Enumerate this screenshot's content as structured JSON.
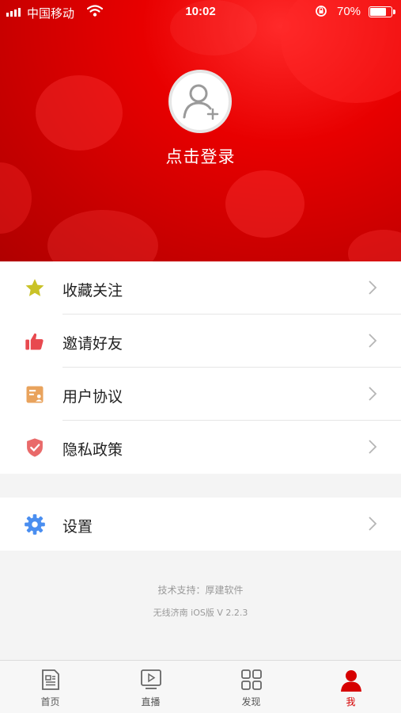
{
  "status_bar": {
    "carrier": "中国移动",
    "time": "10:02",
    "battery_percent": "70%",
    "battery_level": 0.7
  },
  "profile": {
    "login_label": "点击登录"
  },
  "menu": {
    "items": [
      {
        "label": "收藏关注",
        "icon": "star-icon"
      },
      {
        "label": "邀请好友",
        "icon": "thumbs-up-icon"
      },
      {
        "label": "用户协议",
        "icon": "document-icon"
      },
      {
        "label": "隐私政策",
        "icon": "shield-icon"
      }
    ],
    "settings": {
      "label": "设置",
      "icon": "gear-icon"
    }
  },
  "footer": {
    "support": "技术支持：厚建软件",
    "version": "无线济南 iOS版 V 2.2.3"
  },
  "tabbar": {
    "tabs": [
      {
        "label": "首页",
        "icon": "news-icon"
      },
      {
        "label": "直播",
        "icon": "play-icon"
      },
      {
        "label": "发现",
        "icon": "grid-icon"
      },
      {
        "label": "我",
        "icon": "user-icon"
      }
    ],
    "active": 3
  },
  "colors": {
    "brand_red": "#d60000",
    "star": "#c9c227",
    "thumb": "#e8494f",
    "document": "#e9a35d",
    "shield": "#e96a6a",
    "gear": "#4a8ef0"
  }
}
